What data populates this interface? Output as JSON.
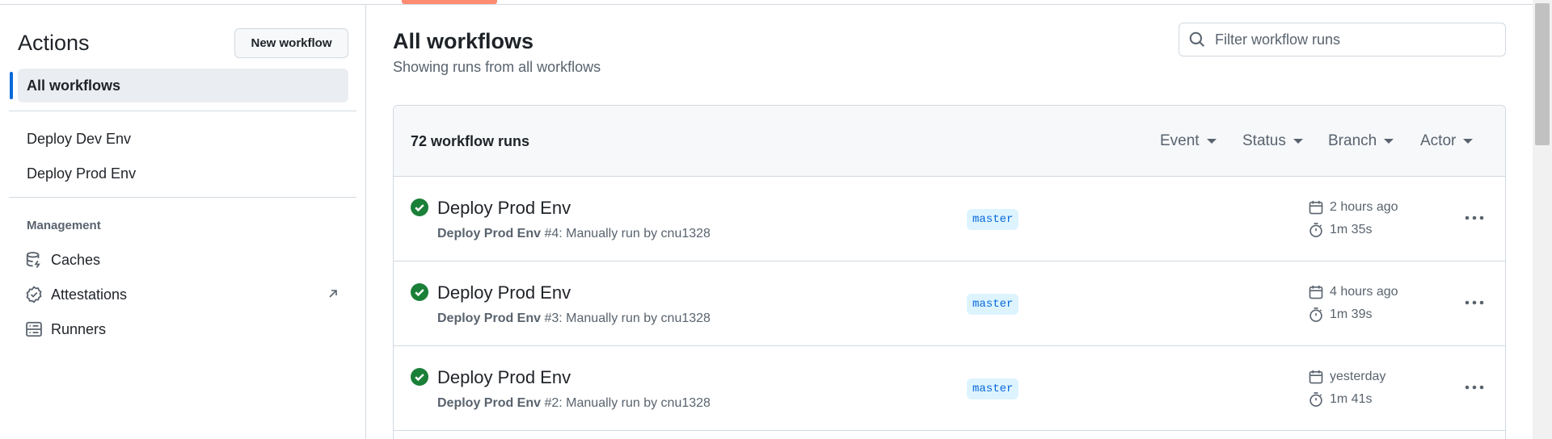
{
  "sidebar": {
    "title": "Actions",
    "new_workflow_label": "New workflow",
    "all_workflows_label": "All workflows",
    "workflows": [
      {
        "label": "Deploy Dev Env"
      },
      {
        "label": "Deploy Prod Env"
      }
    ],
    "management_label": "Management",
    "management_items": [
      {
        "label": "Caches",
        "icon": "database-icon"
      },
      {
        "label": "Attestations",
        "icon": "verified-icon",
        "external": true
      },
      {
        "label": "Runners",
        "icon": "server-icon"
      }
    ]
  },
  "main": {
    "title": "All workflows",
    "subtitle": "Showing runs from all workflows",
    "filter_placeholder": "Filter workflow runs",
    "runs_count": "72 workflow runs",
    "filters": [
      {
        "label": "Event"
      },
      {
        "label": "Status"
      },
      {
        "label": "Branch"
      },
      {
        "label": "Actor"
      }
    ],
    "runs": [
      {
        "title": "Deploy Prod Env",
        "workflow": "Deploy Prod Env",
        "meta": " #4: Manually run by cnu1328",
        "branch": "master",
        "when": "2 hours ago",
        "duration": "1m 35s",
        "status": "success"
      },
      {
        "title": "Deploy Prod Env",
        "workflow": "Deploy Prod Env",
        "meta": " #3: Manually run by cnu1328",
        "branch": "master",
        "when": "4 hours ago",
        "duration": "1m 39s",
        "status": "success"
      },
      {
        "title": "Deploy Prod Env",
        "workflow": "Deploy Prod Env",
        "meta": " #2: Manually run by cnu1328",
        "branch": "master",
        "when": "yesterday",
        "duration": "1m 41s",
        "status": "success"
      }
    ]
  },
  "colors": {
    "accent": "#0969da",
    "success": "#1a7f37",
    "tab_underline": "#fd8c73",
    "branch_bg": "#ddf4ff"
  }
}
